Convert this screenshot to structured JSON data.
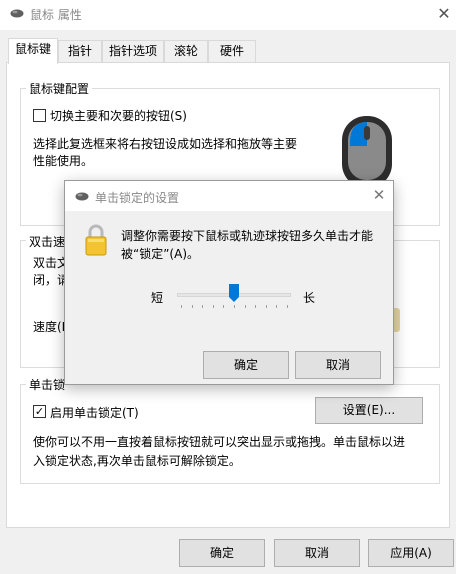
{
  "window": {
    "title": "鼠标 属性",
    "close_glyph": "✕"
  },
  "tabs": [
    {
      "label": "鼠标键",
      "active": true
    },
    {
      "label": "指针",
      "active": false
    },
    {
      "label": "指针选项",
      "active": false
    },
    {
      "label": "滚轮",
      "active": false
    },
    {
      "label": "硬件",
      "active": false
    }
  ],
  "button_config": {
    "title": "鼠标键配置",
    "switch_label": "切换主要和次要的按钮(S)",
    "switch_checked": false,
    "description_line1": "选择此复选框来将右按钮设成如选择和拖放等主要",
    "description_line2": "性能使用。"
  },
  "double_click": {
    "title_partial": "双击速",
    "desc_line1_partial": "双击文",
    "desc_line2_partial": "闭，请",
    "speed_partial": "速度(D"
  },
  "click_lock": {
    "title_partial": "单击锁",
    "enable_label": "启用单击锁定(T)",
    "enable_checked": true,
    "settings_button": "设置(E)...",
    "description_line1": "使你可以不用一直按着鼠标按钮就可以突出显示或拖拽。单击鼠标以进",
    "description_line2": "入锁定状态,再次单击鼠标可解除锁定。"
  },
  "footer": {
    "ok": "确定",
    "cancel": "取消",
    "apply": "应用(A)"
  },
  "dialog": {
    "title": "单击锁定的设置",
    "close_glyph": "✕",
    "message_line1": "调整你需要按下鼠标或轨迹球按钮多久单击才能",
    "message_line2": "被“锁定”(A)。",
    "slider_min_label": "短",
    "slider_max_label": "长",
    "slider_fraction": 0.5,
    "ok": "确定",
    "cancel": "取消"
  },
  "colors": {
    "accent": "#0078d7",
    "lock_gold": "#f4c430"
  }
}
